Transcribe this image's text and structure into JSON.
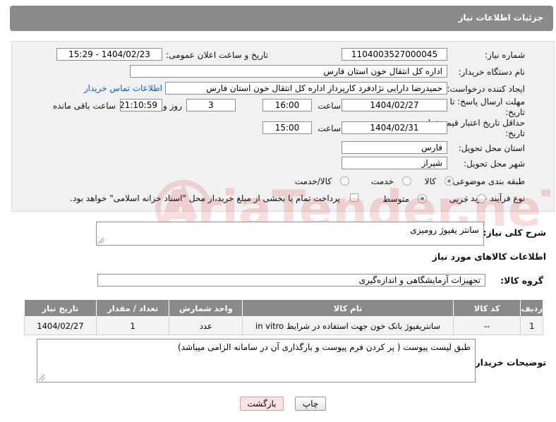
{
  "header": {
    "title": "جزئیات اطلاعات نیاز"
  },
  "form": {
    "need_number_label": "شماره نیاز:",
    "need_number": "1104003527000045",
    "announce_label": "تاریخ و ساعت اعلان عمومی:",
    "announce_value": "1404/02/23 - 15:29",
    "buyer_org_label": "نام دستگاه خریدار:",
    "buyer_org": "اداره کل انتقال خون استان فارس",
    "creator_label": "ایجاد کننده درخواست:",
    "creator": "حمیدرضا دارایی نژادفرد کارپرداز اداره کل انتقال خون استان فارس",
    "buyer_contact_link": "اطلاعات تماس خریدار",
    "reply_deadline_label": "مهلت ارسال پاسخ: تا تاریخ:",
    "reply_date": "1404/02/27",
    "time_label": "ساعت",
    "reply_time": "16:00",
    "days": "3",
    "days_label": "روز و",
    "remaining": "21:10:59",
    "remaining_label": "ساعت باقی مانده",
    "price_validity_label": "حداقل تاریخ اعتبار قیمت: تا تاریخ:",
    "price_date": "1404/02/31",
    "price_time": "15:00",
    "province_label": "استان محل تحویل:",
    "province": "فارس",
    "city_label": "شهر محل تحویل:",
    "city": "شیراز",
    "category_label": "طبقه بندی موضوعی:",
    "category_options": [
      "کالا",
      "خدمت",
      "کالا/خدمت"
    ],
    "category_selected": "کالا",
    "process_label": "نوع فرآیند خرید :",
    "process_options": [
      "جزیی",
      "متوسط"
    ],
    "process_selected": "متوسط",
    "payment_note": "پرداخت تمام یا بخشی از مبلغ خرید،از محل \"اسناد خزانه اسلامی\" خواهد بود."
  },
  "description": {
    "label": "شرح کلی نیاز:",
    "value": "سانتر یفیوژ رومیزی"
  },
  "goods_info": {
    "title": "اطلاعات کالاهای مورد نیاز",
    "group_label": "گروه کالا:",
    "group_value": "تجهیزات آزمایشگاهی و اندازه‌گیری"
  },
  "table": {
    "headers": [
      "ردیف",
      "کد کالا",
      "نام کالا",
      "واحد شمارش",
      "تعداد / مقدار",
      "تاریخ نیاز"
    ],
    "rows": [
      [
        "1",
        "--",
        "سانتریفیوژ بانک خون جهت استفاده در شرایط in vitro",
        "عدد",
        "1",
        "1404/02/27"
      ]
    ]
  },
  "buyer_notes": {
    "label": "توضیحات خریدار:",
    "value": "طبق لیست پیوست ( پر کردن فرم پیوست و بارگذاری آن در سامانه الزامی میباشد)"
  },
  "buttons": {
    "print": "چاپ",
    "back": "بازگشت"
  },
  "watermark": {
    "text": "AriaTender.neT"
  }
}
